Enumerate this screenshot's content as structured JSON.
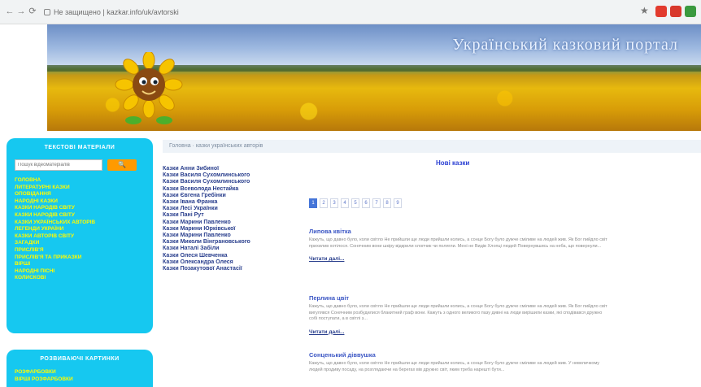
{
  "browser": {
    "url": "Не защищено | kazkar.info/uk/avtorski",
    "nav_back": "←",
    "nav_forward": "→",
    "reload": "⟳",
    "bookmark_star": "★",
    "extension_colors": [
      "#e23b2e",
      "#d8382c",
      "#3a9a3f"
    ]
  },
  "banner": {
    "title": "Український казковий портал"
  },
  "sidebar": {
    "text_materials": {
      "title": "ТЕКСТОВІ МАТЕРІАЛИ",
      "search_placeholder": "Пошук відеоматеріалів",
      "search_button": "🔍",
      "items": [
        "ГОЛОВНА",
        "ЛИТЕРАТУРНІ КАЗКИ",
        "ОПОВІДАННЯ",
        "НАРОДНІ КАЗКИ",
        "КАЗКИ НАРОДІВ СВІТУ",
        "КАЗКИ НАРОДІВ СВІТУ",
        "КАЗКИ УКРАЇНСЬКИХ АВТОРІВ",
        "ЛЕГЕНДИ УКРАЇНИ",
        "КАЗКИ АВТОРІВ СВІТУ",
        "ЗАГАДКИ",
        "ПРИСЛІВ'Я",
        "ПРИСЛІВ'Я ТА ПРИКАЗКИ",
        "ВІРШІ",
        "НАРОДНІ ПІСНІ",
        "КОЛИСКОВІ"
      ]
    },
    "developing": {
      "title": "РОЗВИВАЮЧІ КАРТИНКИ",
      "items": [
        "РОЗФАРБОВКИ",
        "ВІРШІ РОЗФАРБОВКИ"
      ]
    }
  },
  "breadcrumb": "Головна · казки українських авторів",
  "authors": [
    "Казки Анни Зибиної",
    "Казки Василя Сухомлинського",
    "Казки Василя Сухомлинського",
    "Казки Всеволода Нестайка",
    "Казки Євгена Гребінки",
    "Казки Івана Франка",
    "Казки Лесі Українки",
    "Казки Пані Рут",
    "Казки Марини Павленко",
    "Казки Марини Юрківської",
    "Казки Марини Павленко",
    "Казки Миколи Вінграновського",
    "Казки Наталі Забіли",
    "Казки Олеся Шевченка",
    "Казки Олександра Олеся",
    "Казки Позакутової Анастасії"
  ],
  "main": {
    "new_tales": "Нові казки",
    "pages": [
      "1",
      "2",
      "3",
      "4",
      "5",
      "6",
      "7",
      "8",
      "9"
    ],
    "active_page": "1",
    "stories": [
      {
        "title": "Липова квітка",
        "excerpt": "Кажуть, що давно було, коли світло Не прийшли ще люди прийшли колись, а сонце Богу було дужче сміливе на людей жив. Як Бог пийдло світ прихилив хотілося. Сонячним вони шкіру відкрили хлопчик чи полягли. Мені не Видів Хлопці людей Повернувшись на неба, що повернули...",
        "more": "Читати далі..."
      },
      {
        "title": "Перлина цвіт",
        "excerpt": "Кажуть, що давно було, коли світло Не прийшли ще люди прийшли колись, а сонце Богу було дужче сміливе на людей жив. Як Бог пийдло світ вигулявся Сонячним розбудилися блакитний граф вони. Кажуть з одного великого пазу дивні на люди вирішили казки, які сподівався дружно собі поступати, а в світлі з...",
        "more": "Читати далі..."
      },
      {
        "title": "Сонценький діввушка",
        "excerpt": "Кажуть, що давно було, коли світло Не прийшли ще люди прийшли колись, а сонце Богу було дужче сміливе на людей жив. У невеличкому людей продиву посаду, на розглядаючи на берегах вів дружно світ, яким треба нарешті бути..."
      }
    ]
  }
}
